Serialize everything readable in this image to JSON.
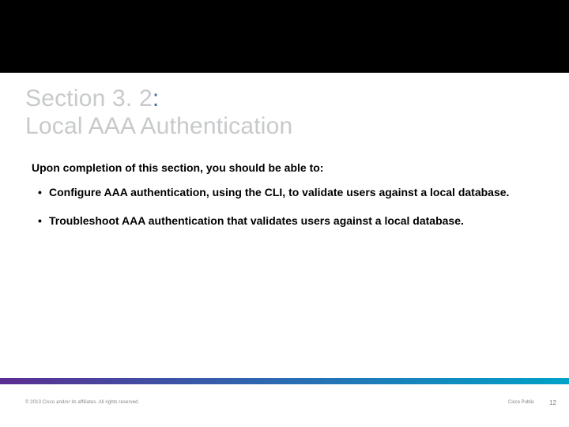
{
  "title": {
    "line1_prefix": "Section 3. 2",
    "line1_colon": ":",
    "line2": "Local AAA Authentication"
  },
  "intro": "Upon completion of this section, you should be able to:",
  "bullets": [
    "Configure AAA authentication, using the CLI, to validate users against a local database.",
    "Troubleshoot AAA authentication that validates users against a local database."
  ],
  "footer": {
    "left": "© 2013 Cisco and/or its affiliates. All rights reserved.",
    "right": "Cisco Public",
    "page": "12"
  }
}
